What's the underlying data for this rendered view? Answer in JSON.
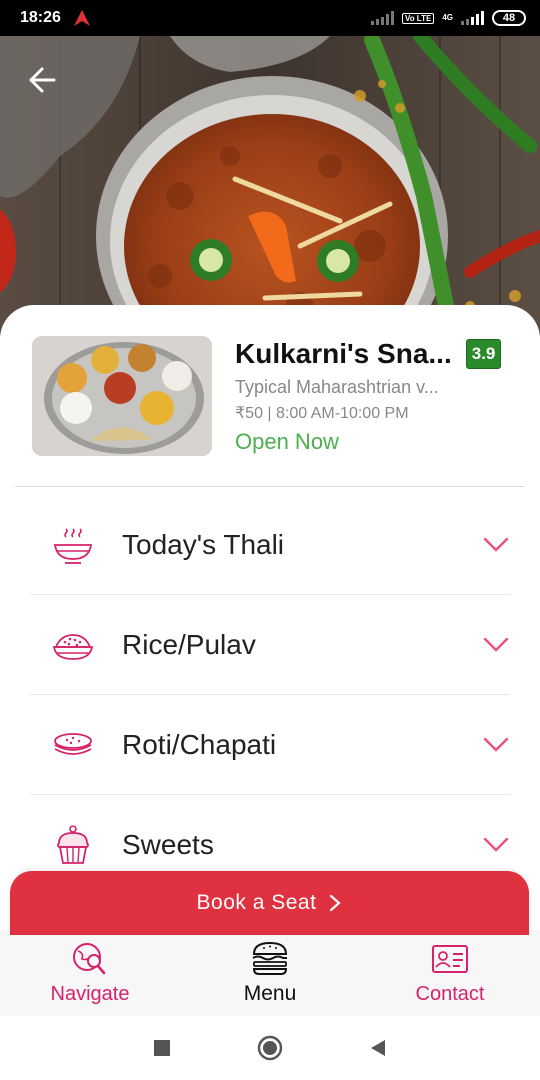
{
  "status_bar": {
    "time": "18:26",
    "volte": "Vo LTE",
    "network": "4G",
    "battery": "48"
  },
  "hero": {
    "image_desc": "curry-dish-photo"
  },
  "restaurant": {
    "name": "Kulkarni's Sna...",
    "rating": "3.9",
    "cuisine": "Typical Maharashtrian v...",
    "price_hours": "₹50 | 8:00 AM-10:00 PM",
    "status": "Open Now"
  },
  "categories": [
    {
      "label": "Today's Thali",
      "icon": "thali-bowl-icon"
    },
    {
      "label": "Rice/Pulav",
      "icon": "rice-bowl-icon"
    },
    {
      "label": "Roti/Chapati",
      "icon": "roti-icon"
    },
    {
      "label": "Sweets",
      "icon": "cupcake-icon"
    }
  ],
  "book_button": {
    "label": "Book a Seat"
  },
  "bottom_nav": {
    "navigate": "Navigate",
    "menu": "Menu",
    "contact": "Contact"
  },
  "colors": {
    "accent": "#e03140",
    "pink": "#d6226a",
    "open_green": "#4caf50",
    "rating_green": "#2a8a2a"
  }
}
